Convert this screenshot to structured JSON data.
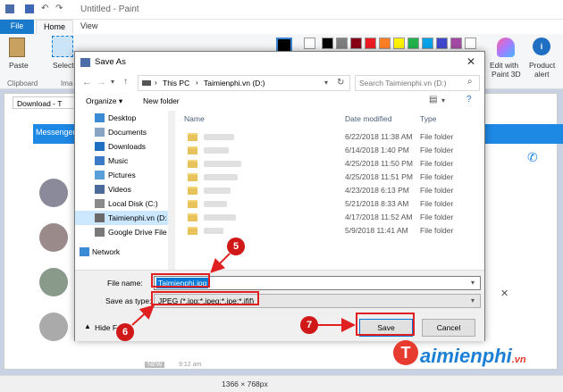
{
  "paint": {
    "title": "Untitled - Paint",
    "tabs": [
      "File",
      "Home",
      "View"
    ],
    "ribbon": {
      "paste": "Paste",
      "select": "Select",
      "clipboard": "Clipboard",
      "image_group_fragment": "Ima",
      "edit_with_paint3d_line1": "Edit with",
      "edit_with_paint3d_line2": "Paint 3D",
      "product_alert_line1": "Product",
      "product_alert_line2": "alert"
    },
    "palette": [
      "#000000",
      "#7f7f7f",
      "#880015",
      "#ed1c24",
      "#ff7f27",
      "#fff200",
      "#22b14c",
      "#00a2e8",
      "#3f48cc",
      "#a349a4"
    ],
    "background": {
      "browser_tab": "Download - T",
      "messenger": "Messenger",
      "new_label": "NEW",
      "time": "9:12 am"
    },
    "status": {
      "dimensions": "1366 × 768px"
    }
  },
  "dialog": {
    "title": "Save As",
    "close": "✕",
    "breadcrumb": [
      "This PC",
      "Taimienphi.vn (D:)"
    ],
    "search_placeholder": "Search Taimienphi.vn (D:)",
    "organize": "Organize ▾",
    "new_folder": "New folder",
    "nav_items": [
      {
        "label": "Desktop",
        "icon": "desktop-icon"
      },
      {
        "label": "Documents",
        "icon": "documents-icon"
      },
      {
        "label": "Downloads",
        "icon": "downloads-icon"
      },
      {
        "label": "Music",
        "icon": "music-icon"
      },
      {
        "label": "Pictures",
        "icon": "pictures-icon"
      },
      {
        "label": "Videos",
        "icon": "videos-icon"
      },
      {
        "label": "Local Disk (C:)",
        "icon": "drive-icon"
      },
      {
        "label": "Taimienphi.vn (D:",
        "icon": "drive-icon"
      },
      {
        "label": "Google Drive File",
        "icon": "drive-icon"
      },
      {
        "label": "Network",
        "icon": "network-icon"
      }
    ],
    "columns": {
      "name": "Name",
      "date": "Date modified",
      "type": "Type"
    },
    "files": [
      {
        "date": "6/22/2018 11:38 AM",
        "type": "File folder"
      },
      {
        "date": "6/14/2018 1:40 PM",
        "type": "File folder"
      },
      {
        "date": "4/25/2018 11:50 PM",
        "type": "File folder"
      },
      {
        "date": "4/25/2018 11:51 PM",
        "type": "File folder"
      },
      {
        "date": "4/23/2018 6:13 PM",
        "type": "File folder"
      },
      {
        "date": "5/21/2018 8:33 AM",
        "type": "File folder"
      },
      {
        "date": "4/17/2018 11:52 AM",
        "type": "File folder"
      },
      {
        "date": "5/9/2018 11:41 AM",
        "type": "File folder"
      }
    ],
    "file_name_label": "File name:",
    "file_name_value": "Taimienphi.jpg",
    "save_as_type_label": "Save as type:",
    "save_as_type_value": "JPEG (*.jpg;*.jpeg;*.jpe;*.jfif)",
    "hide_folders": "Hide Fo",
    "save_button": "Save",
    "cancel_button": "Cancel"
  },
  "annotations": {
    "step5": "5",
    "step6": "6",
    "step7": "7",
    "color": "#e02020"
  },
  "brand": {
    "text": "aimienphi",
    "suffix": ".vn",
    "letter": "T"
  }
}
